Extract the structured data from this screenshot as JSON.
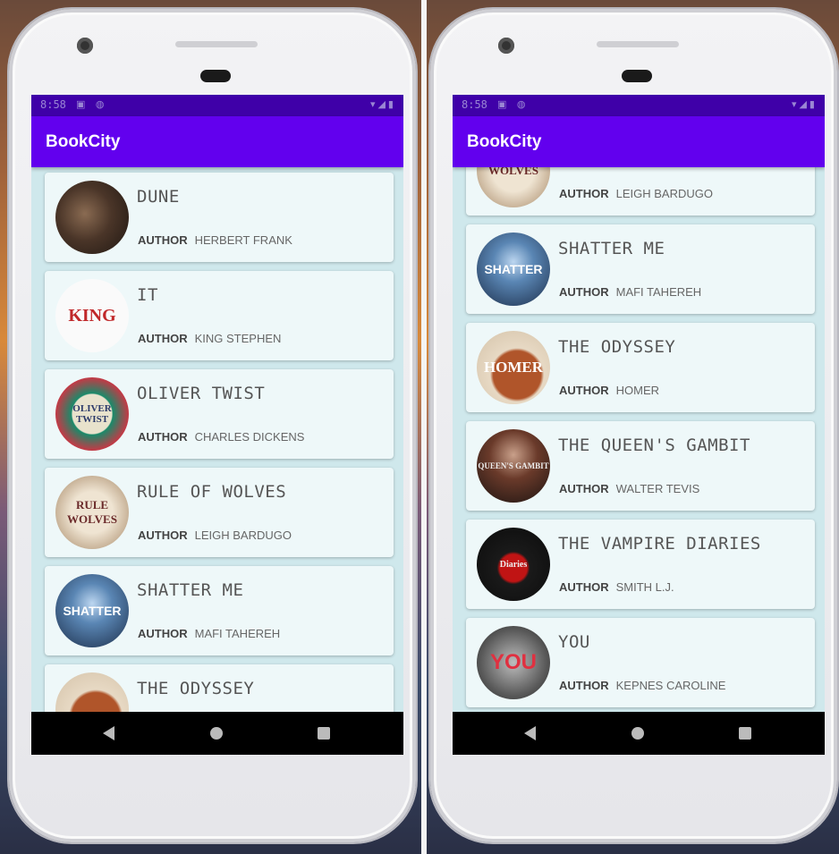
{
  "app": {
    "title": "BookCity",
    "status_time": "8:58",
    "status_icons": "▣ ◍",
    "status_right": "▾◢▮"
  },
  "author_label": "AUTHOR",
  "left_screen": {
    "books": [
      {
        "title": "DUNE",
        "author": "HERBERT FRANK",
        "cover_icon": "dune-cover",
        "cover_text": ""
      },
      {
        "title": "IT",
        "author": "KING STEPHEN",
        "cover_icon": "it-cover",
        "cover_text": "KING"
      },
      {
        "title": "OLIVER TWIST",
        "author": "CHARLES DICKENS",
        "cover_icon": "oliver-twist-cover",
        "cover_text": "OLIVER TWIST"
      },
      {
        "title": "RULE OF WOLVES",
        "author": "LEIGH BARDUGO",
        "cover_icon": "rule-of-wolves-cover",
        "cover_text": "RULE WOLVES"
      },
      {
        "title": "SHATTER ME",
        "author": "MAFI TAHEREH",
        "cover_icon": "shatter-me-cover",
        "cover_text": "SHATTER"
      },
      {
        "title": "THE ODYSSEY",
        "author": "",
        "cover_icon": "odyssey-cover",
        "cover_text": ""
      }
    ]
  },
  "right_screen": {
    "books": [
      {
        "title": "",
        "author": "LEIGH BARDUGO",
        "cover_icon": "rule-of-wolves-cover",
        "cover_text": "WOLVES"
      },
      {
        "title": "SHATTER ME",
        "author": "MAFI TAHEREH",
        "cover_icon": "shatter-me-cover",
        "cover_text": "SHATTER"
      },
      {
        "title": "THE ODYSSEY",
        "author": "HOMER",
        "cover_icon": "odyssey-cover",
        "cover_text": "HOMER"
      },
      {
        "title": "THE QUEEN'S GAMBIT",
        "author": "WALTER TEVIS",
        "cover_icon": "queens-gambit-cover",
        "cover_text": "QUEEN'S GAMBIT"
      },
      {
        "title": "THE VAMPIRE DIARIES",
        "author": "SMITH L.J.",
        "cover_icon": "vampire-diaries-cover",
        "cover_text": "Diaries"
      },
      {
        "title": "YOU",
        "author": "KEPNES CAROLINE",
        "cover_icon": "you-cover",
        "cover_text": "YOU"
      }
    ]
  },
  "colors": {
    "status_bar": "#3f00a8",
    "app_bar": "#6200ee",
    "list_bg": "#cfe8ec",
    "card_bg": "#eef8f9"
  }
}
